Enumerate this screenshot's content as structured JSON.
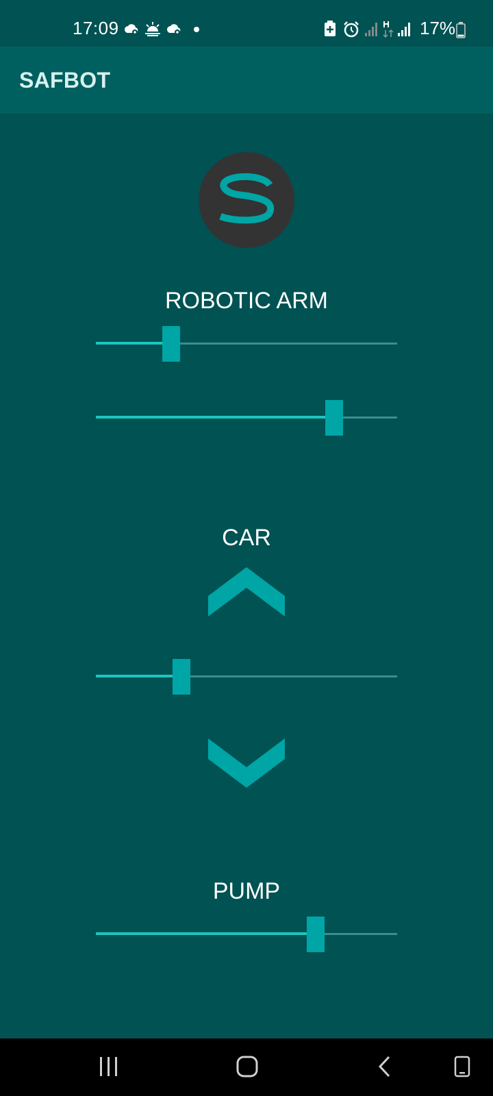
{
  "status_bar": {
    "time": "17:09",
    "battery_percent": "17%",
    "battery_level": 0.17,
    "icons_left": [
      "weather-cloud-icon",
      "sunrise-icon",
      "weather-cloud-icon",
      "notification-dot-icon"
    ],
    "icons_right": [
      "battery-saver-icon",
      "alarm-icon",
      "signal-icon",
      "data-h-icon",
      "signal-icon",
      "battery-icon"
    ]
  },
  "app_bar": {
    "title": "SAFBOT"
  },
  "logo": {
    "icon": "safbot-s-logo-icon"
  },
  "sections": {
    "robotic_arm": {
      "title": "ROBOTIC ARM",
      "slider_1_value": 0.25,
      "slider_2_value": 0.79
    },
    "car": {
      "title": "CAR",
      "up_icon": "chevron-up-icon",
      "slider_value": 0.285,
      "down_icon": "chevron-down-icon"
    },
    "pump": {
      "title": "PUMP",
      "slider_value": 0.73
    }
  },
  "nav_bar": {
    "icons": [
      "recent-apps-icon",
      "home-icon",
      "back-icon",
      "keyboard-icon"
    ]
  },
  "colors": {
    "background": "#005253",
    "app_bar": "#00605F",
    "accent": "#00A5A6",
    "track_active": "#1cc6bf",
    "logo_circle": "#333333"
  }
}
